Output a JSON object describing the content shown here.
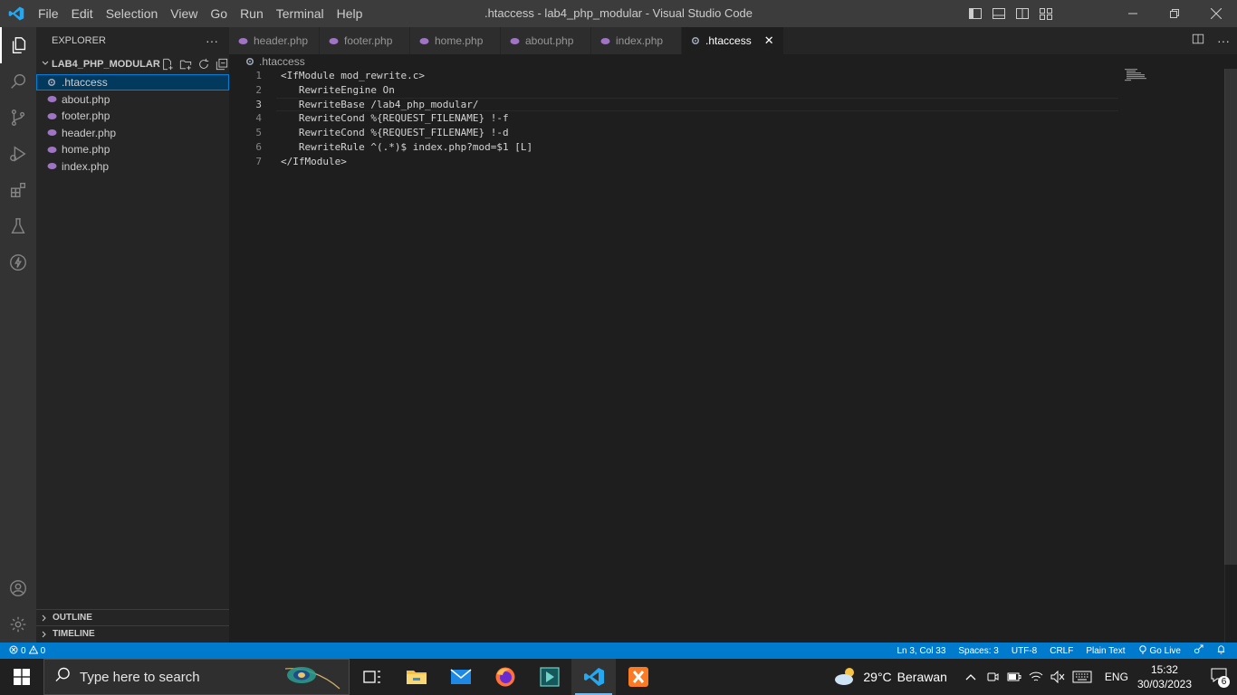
{
  "window": {
    "title": ".htaccess - lab4_php_modular - Visual Studio Code"
  },
  "menu": [
    "File",
    "Edit",
    "Selection",
    "View",
    "Go",
    "Run",
    "Terminal",
    "Help"
  ],
  "sidebar": {
    "header": "EXPLORER",
    "more": "···",
    "folder": "LAB4_PHP_MODULAR",
    "files": [
      {
        "name": ".htaccess",
        "icon": "gear-icon",
        "selected": true
      },
      {
        "name": "about.php",
        "icon": "php-icon"
      },
      {
        "name": "footer.php",
        "icon": "php-icon"
      },
      {
        "name": "header.php",
        "icon": "php-icon"
      },
      {
        "name": "home.php",
        "icon": "php-icon"
      },
      {
        "name": "index.php",
        "icon": "php-icon"
      }
    ],
    "outline": "OUTLINE",
    "timeline": "TIMELINE"
  },
  "tabs": [
    {
      "label": "header.php",
      "icon": "php-icon"
    },
    {
      "label": "footer.php",
      "icon": "php-icon"
    },
    {
      "label": "home.php",
      "icon": "php-icon"
    },
    {
      "label": "about.php",
      "icon": "php-icon"
    },
    {
      "label": "index.php",
      "icon": "php-icon"
    },
    {
      "label": ".htaccess",
      "icon": "gear-icon",
      "active": true,
      "close": "✕"
    }
  ],
  "breadcrumb": ".htaccess",
  "editor": {
    "current_line": 3,
    "lines": [
      {
        "n": "1",
        "text": "<IfModule mod_rewrite.c>"
      },
      {
        "n": "2",
        "text": "   RewriteEngine On"
      },
      {
        "n": "3",
        "text": "   RewriteBase /lab4_php_modular/"
      },
      {
        "n": "4",
        "text": "   RewriteCond %{REQUEST_FILENAME} !-f"
      },
      {
        "n": "5",
        "text": "   RewriteCond %{REQUEST_FILENAME} !-d"
      },
      {
        "n": "6",
        "text": "   RewriteRule ^(.*)$ index.php?mod=$1 [L]"
      },
      {
        "n": "7",
        "text": "</IfModule>"
      }
    ]
  },
  "statusbar": {
    "errors": "0",
    "warnings": "0",
    "position": "Ln 3, Col 33",
    "spaces": "Spaces: 3",
    "encoding": "UTF-8",
    "eol": "CRLF",
    "language": "Plain Text",
    "golive": "Go Live"
  },
  "taskbar": {
    "search_placeholder": "Type here to search",
    "weather_temp": "29°C",
    "weather_desc": "Berawan",
    "lang": "ENG",
    "time": "15:32",
    "date": "30/03/2023",
    "notif_count": "6"
  },
  "colors": {
    "accent": "#007acc",
    "php_icon": "#a074c4",
    "selection": "#04395e"
  }
}
